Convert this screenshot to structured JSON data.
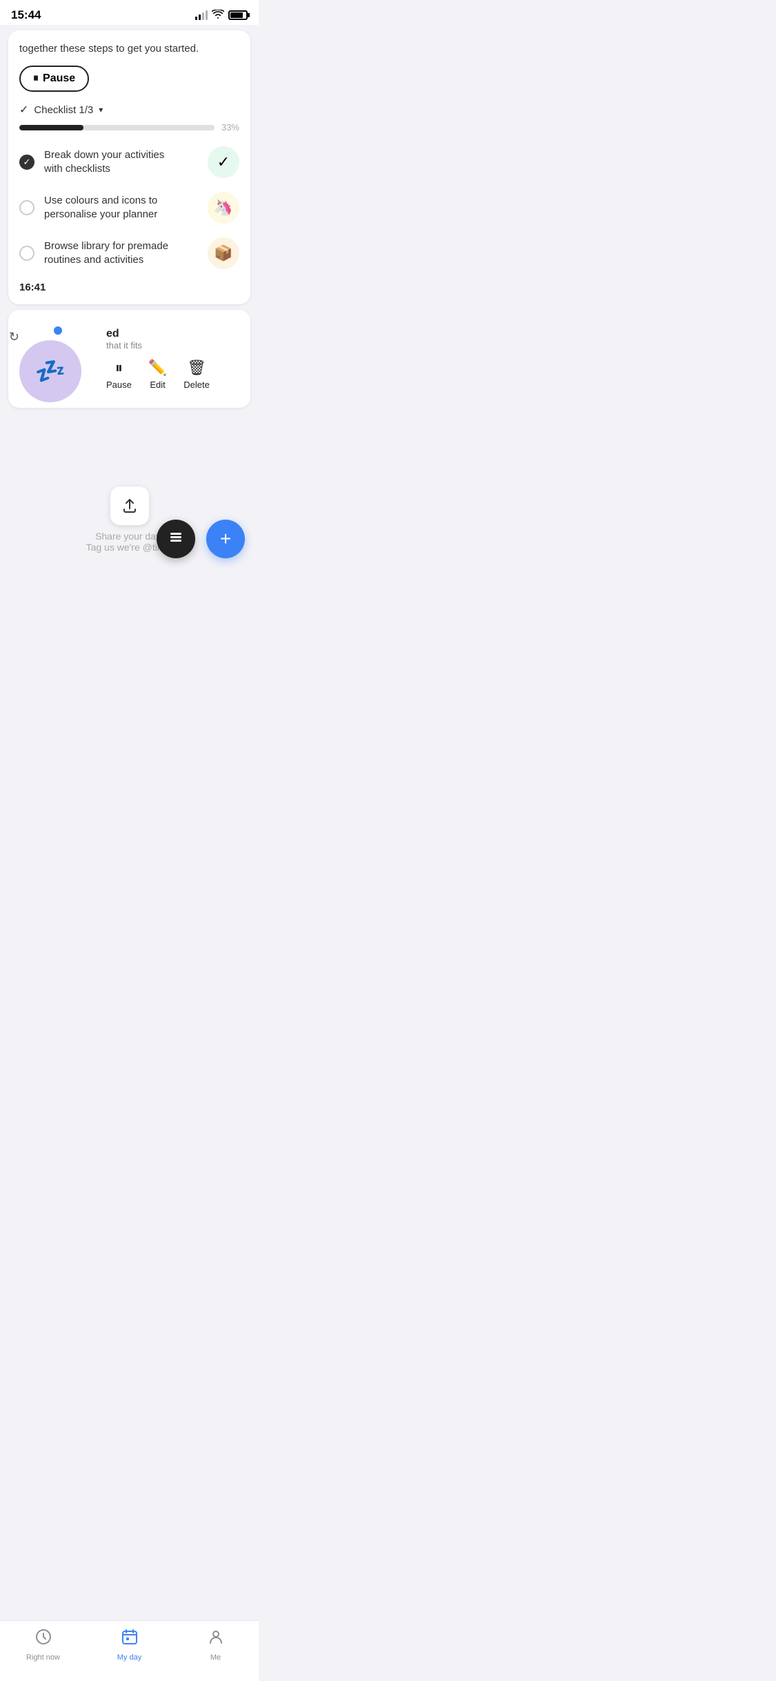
{
  "statusBar": {
    "time": "15:44",
    "icons": {
      "signal": "signal",
      "wifi": "wifi",
      "battery": "battery"
    }
  },
  "tutorialCard": {
    "headerText": "together these steps to get you started.",
    "pauseButton": "⏸ Pause",
    "checklist": {
      "title": "Checklist 1/3",
      "progressPct": "33%",
      "progressValue": 33,
      "items": [
        {
          "label": "Break down your activities with checklists",
          "checked": true,
          "iconEmoji": "✓",
          "iconBg": "green"
        },
        {
          "label": "Use colours and icons to personalise your planner",
          "checked": false,
          "iconEmoji": "🦄",
          "iconBg": "yellow"
        },
        {
          "label": "Browse library for premade routines and activities",
          "checked": false,
          "iconEmoji": "📦",
          "iconBg": "orange"
        }
      ]
    },
    "timestamp": "16:41"
  },
  "activityCard": {
    "title": "ed",
    "subtitle": "that it fits",
    "iconEmoji": "💤",
    "repeatLabel": "↻",
    "actions": [
      {
        "icon": "⏸",
        "label": "Pause"
      },
      {
        "icon": "✏️",
        "label": "Edit"
      },
      {
        "icon": "🗑",
        "label": "Delete"
      }
    ]
  },
  "shareSection": {
    "uploadIcon": "↑",
    "text": "Share your day!\nTag us we're @tiimo"
  },
  "fab": {
    "darkIcon": "▣",
    "blueIcon": "+"
  },
  "bottomNav": {
    "items": [
      {
        "id": "right-now",
        "label": "Right now",
        "icon": "🕐",
        "active": false
      },
      {
        "id": "my-day",
        "label": "My day",
        "icon": "📅",
        "active": true
      },
      {
        "id": "me",
        "label": "Me",
        "icon": "👤",
        "active": false
      }
    ]
  }
}
